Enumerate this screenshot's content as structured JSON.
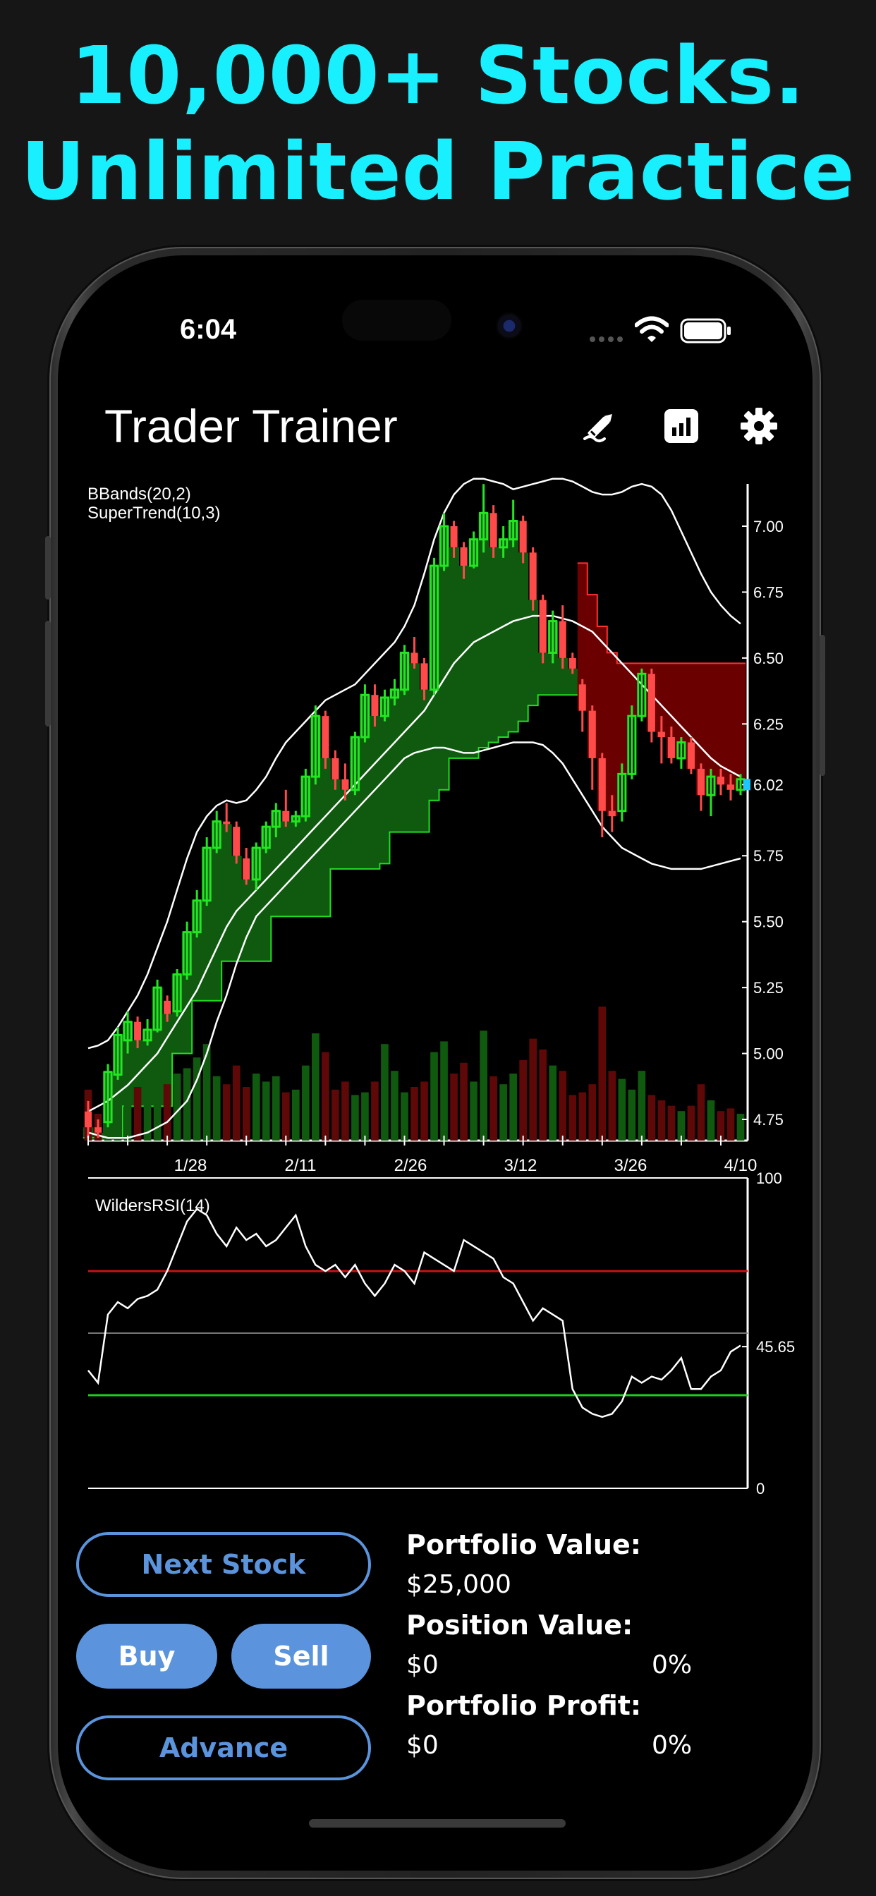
{
  "headline": {
    "line1": "10,000+ Stocks.",
    "line2": "Unlimited Practice"
  },
  "status_bar": {
    "time": "6:04"
  },
  "app": {
    "title": "Trader Trainer"
  },
  "toolbar": {
    "icons": [
      "draw-tool-icon",
      "chart-bar-icon",
      "gear-icon"
    ]
  },
  "colors": {
    "accent_cyan": "#19f0ff",
    "button_blue": "#5b94dc",
    "up": "#22e622",
    "down": "#ff4a4a",
    "fill_up": "#0f5a0f",
    "fill_down": "#6b0000"
  },
  "chart_data": [
    {
      "type": "candlestick",
      "indicators": [
        "BBands(20,2)",
        "SuperTrend(10,3)"
      ],
      "x_labels": [
        "1/28",
        "2/11",
        "2/26",
        "3/12",
        "3/26",
        "4/10"
      ],
      "y_ticks": [
        "7.00",
        "6.75",
        "6.50",
        "6.25",
        "6.02",
        "5.75",
        "5.50",
        "5.25",
        "5.00",
        "4.75"
      ],
      "current_price": "6.02",
      "ylim": [
        4.7,
        7.15
      ],
      "ohlc": [
        [
          4.78,
          4.82,
          4.68,
          4.72
        ],
        [
          4.72,
          4.75,
          4.68,
          4.7
        ],
        [
          4.74,
          4.96,
          4.72,
          4.93
        ],
        [
          4.92,
          5.1,
          4.9,
          5.07
        ],
        [
          5.05,
          5.16,
          5.0,
          5.12
        ],
        [
          5.12,
          5.14,
          5.02,
          5.05
        ],
        [
          5.05,
          5.13,
          5.03,
          5.09
        ],
        [
          5.09,
          5.28,
          5.08,
          5.25
        ],
        [
          5.2,
          5.22,
          5.12,
          5.15
        ],
        [
          5.16,
          5.32,
          5.14,
          5.3
        ],
        [
          5.3,
          5.5,
          5.28,
          5.46
        ],
        [
          5.46,
          5.62,
          5.44,
          5.58
        ],
        [
          5.58,
          5.82,
          5.56,
          5.78
        ],
        [
          5.78,
          5.92,
          5.76,
          5.88
        ],
        [
          5.88,
          5.95,
          5.84,
          5.87
        ],
        [
          5.86,
          5.88,
          5.72,
          5.75
        ],
        [
          5.74,
          5.78,
          5.64,
          5.66
        ],
        [
          5.66,
          5.8,
          5.62,
          5.78
        ],
        [
          5.78,
          5.88,
          5.76,
          5.86
        ],
        [
          5.86,
          5.95,
          5.82,
          5.92
        ],
        [
          5.92,
          6.0,
          5.86,
          5.88
        ],
        [
          5.88,
          5.92,
          5.86,
          5.9
        ],
        [
          5.9,
          6.08,
          5.88,
          6.05
        ],
        [
          6.05,
          6.32,
          6.02,
          6.28
        ],
        [
          6.28,
          6.3,
          6.08,
          6.12
        ],
        [
          6.12,
          6.15,
          6.0,
          6.04
        ],
        [
          6.04,
          6.1,
          5.96,
          6.0
        ],
        [
          6.0,
          6.22,
          5.98,
          6.2
        ],
        [
          6.2,
          6.4,
          6.18,
          6.36
        ],
        [
          6.36,
          6.4,
          6.24,
          6.28
        ],
        [
          6.28,
          6.38,
          6.26,
          6.35
        ],
        [
          6.35,
          6.42,
          6.32,
          6.38
        ],
        [
          6.38,
          6.55,
          6.36,
          6.52
        ],
        [
          6.52,
          6.58,
          6.46,
          6.48
        ],
        [
          6.48,
          6.5,
          6.34,
          6.38
        ],
        [
          6.38,
          6.88,
          6.36,
          6.85
        ],
        [
          6.85,
          7.05,
          6.83,
          7.0
        ],
        [
          7.0,
          7.02,
          6.88,
          6.92
        ],
        [
          6.92,
          6.94,
          6.8,
          6.85
        ],
        [
          6.85,
          6.98,
          6.84,
          6.95
        ],
        [
          6.95,
          7.16,
          6.9,
          7.05
        ],
        [
          7.05,
          7.08,
          6.88,
          6.92
        ],
        [
          6.92,
          7.0,
          6.88,
          6.95
        ],
        [
          6.95,
          7.1,
          6.92,
          7.02
        ],
        [
          7.02,
          7.04,
          6.86,
          6.9
        ],
        [
          6.9,
          6.92,
          6.68,
          6.72
        ],
        [
          6.72,
          6.74,
          6.48,
          6.52
        ],
        [
          6.52,
          6.68,
          6.48,
          6.64
        ],
        [
          6.64,
          6.7,
          6.46,
          6.5
        ],
        [
          6.5,
          6.52,
          6.44,
          6.46
        ],
        [
          6.4,
          6.42,
          6.22,
          6.3
        ],
        [
          6.3,
          6.32,
          6.0,
          6.12
        ],
        [
          6.12,
          6.14,
          5.82,
          5.92
        ],
        [
          5.92,
          5.98,
          5.84,
          5.9
        ],
        [
          5.92,
          6.1,
          5.88,
          6.06
        ],
        [
          6.06,
          6.32,
          6.04,
          6.28
        ],
        [
          6.28,
          6.46,
          6.26,
          6.44
        ],
        [
          6.44,
          6.46,
          6.18,
          6.22
        ],
        [
          6.22,
          6.28,
          6.1,
          6.2
        ],
        [
          6.2,
          6.24,
          6.1,
          6.12
        ],
        [
          6.12,
          6.2,
          6.08,
          6.18
        ],
        [
          6.18,
          6.2,
          6.06,
          6.08
        ],
        [
          6.08,
          6.1,
          5.92,
          5.98
        ],
        [
          5.98,
          6.08,
          5.9,
          6.05
        ],
        [
          6.05,
          6.08,
          5.98,
          6.02
        ],
        [
          6.02,
          6.06,
          5.96,
          6.0
        ],
        [
          6.0,
          6.06,
          5.98,
          6.04
        ]
      ],
      "bb_upper": [
        5.02,
        5.03,
        5.05,
        5.1,
        5.16,
        5.22,
        5.3,
        5.4,
        5.5,
        5.62,
        5.74,
        5.84,
        5.9,
        5.94,
        5.96,
        5.95,
        5.96,
        6.0,
        6.05,
        6.12,
        6.18,
        6.22,
        6.26,
        6.3,
        6.34,
        6.36,
        6.38,
        6.4,
        6.44,
        6.48,
        6.52,
        6.56,
        6.62,
        6.7,
        6.82,
        6.95,
        7.05,
        7.12,
        7.16,
        7.18,
        7.18,
        7.17,
        7.16,
        7.14,
        7.15,
        7.16,
        7.17,
        7.18,
        7.18,
        7.17,
        7.15,
        7.13,
        7.12,
        7.12,
        7.13,
        7.15,
        7.16,
        7.15,
        7.12,
        7.06,
        6.98,
        6.9,
        6.82,
        6.75,
        6.7,
        6.66,
        6.63
      ],
      "bb_mid": [
        4.78,
        4.8,
        4.82,
        4.85,
        4.88,
        4.92,
        4.96,
        5.0,
        5.06,
        5.12,
        5.18,
        5.24,
        5.32,
        5.4,
        5.48,
        5.54,
        5.58,
        5.62,
        5.66,
        5.7,
        5.74,
        5.78,
        5.82,
        5.86,
        5.9,
        5.94,
        5.98,
        6.02,
        6.06,
        6.1,
        6.14,
        6.18,
        6.22,
        6.26,
        6.3,
        6.36,
        6.42,
        6.48,
        6.52,
        6.56,
        6.58,
        6.6,
        6.62,
        6.64,
        6.65,
        6.66,
        6.66,
        6.66,
        6.65,
        6.64,
        6.62,
        6.6,
        6.56,
        6.52,
        6.48,
        6.44,
        6.4,
        6.36,
        6.32,
        6.28,
        6.24,
        6.2,
        6.16,
        6.12,
        6.09,
        6.07,
        6.05
      ],
      "bb_lower": [
        4.7,
        4.69,
        4.68,
        4.68,
        4.68,
        4.69,
        4.7,
        4.72,
        4.74,
        4.78,
        4.82,
        4.9,
        5.0,
        5.12,
        5.22,
        5.34,
        5.44,
        5.52,
        5.56,
        5.6,
        5.64,
        5.68,
        5.72,
        5.76,
        5.8,
        5.84,
        5.88,
        5.92,
        5.96,
        6.0,
        6.04,
        6.08,
        6.12,
        6.14,
        6.15,
        6.16,
        6.16,
        6.15,
        6.14,
        6.14,
        6.15,
        6.16,
        6.17,
        6.18,
        6.18,
        6.18,
        6.17,
        6.14,
        6.1,
        6.04,
        5.98,
        5.92,
        5.86,
        5.82,
        5.78,
        5.76,
        5.74,
        5.72,
        5.71,
        5.7,
        5.7,
        5.7,
        5.7,
        5.71,
        5.72,
        5.73,
        5.74
      ],
      "supertrend": [
        4.68,
        4.68,
        4.68,
        4.68,
        4.8,
        4.8,
        4.8,
        4.8,
        4.8,
        5.0,
        5.0,
        5.2,
        5.2,
        5.2,
        5.35,
        5.35,
        5.35,
        5.35,
        5.35,
        5.52,
        5.52,
        5.52,
        5.52,
        5.52,
        5.52,
        5.7,
        5.7,
        5.7,
        5.7,
        5.7,
        5.72,
        5.84,
        5.84,
        5.84,
        5.84,
        5.96,
        6.0,
        6.12,
        6.12,
        6.12,
        6.16,
        6.18,
        6.2,
        6.22,
        6.26,
        6.32,
        6.36,
        6.36,
        6.36,
        6.36,
        6.86,
        6.74,
        6.62,
        6.52,
        6.48,
        6.48,
        6.48,
        6.48,
        6.48,
        6.48,
        6.48,
        6.48,
        6.48,
        6.48,
        6.48,
        6.48,
        6.48
      ],
      "volume": [
        0.38,
        0.2,
        0.48,
        0.52,
        0.58,
        0.4,
        0.44,
        0.6,
        0.42,
        0.5,
        0.54,
        0.62,
        0.72,
        0.48,
        0.42,
        0.56,
        0.4,
        0.5,
        0.44,
        0.48,
        0.36,
        0.38,
        0.56,
        0.8,
        0.66,
        0.38,
        0.44,
        0.34,
        0.36,
        0.44,
        0.72,
        0.52,
        0.36,
        0.4,
        0.44,
        0.66,
        0.74,
        0.5,
        0.58,
        0.44,
        0.82,
        0.48,
        0.42,
        0.5,
        0.6,
        0.76,
        0.68,
        0.56,
        0.52,
        0.34,
        0.36,
        0.42,
        1.0,
        0.52,
        0.46,
        0.38,
        0.52,
        0.34,
        0.3,
        0.26,
        0.22,
        0.26,
        0.42,
        0.3,
        0.22,
        0.24,
        0.2
      ]
    },
    {
      "type": "line",
      "indicator": "WildersRSI(14)",
      "y_ticks": [
        "100",
        "45.65",
        "0"
      ],
      "current_value": "45.65",
      "levels": {
        "overbought": 70,
        "mid": 50,
        "oversold": 30
      },
      "ylim": [
        0,
        100
      ],
      "values": [
        38,
        34,
        56,
        60,
        58,
        61,
        62,
        64,
        70,
        78,
        86,
        90,
        88,
        82,
        78,
        84,
        80,
        82,
        78,
        80,
        84,
        88,
        78,
        72,
        70,
        72,
        68,
        72,
        66,
        62,
        66,
        72,
        70,
        66,
        76,
        74,
        72,
        70,
        80,
        78,
        76,
        74,
        68,
        66,
        60,
        54,
        58,
        56,
        54,
        32,
        26,
        24,
        23,
        24,
        28,
        36,
        34,
        36,
        35,
        38,
        42,
        32,
        32,
        36,
        38,
        44,
        46
      ]
    }
  ],
  "buttons": {
    "next_stock": "Next Stock",
    "buy": "Buy",
    "sell": "Sell",
    "advance": "Advance"
  },
  "stats": {
    "portfolio_value_label": "Portfolio Value:",
    "portfolio_value": "$25,000",
    "position_value_label": "Position Value:",
    "position_value": "$0",
    "position_pct": "0%",
    "portfolio_profit_label": "Portfolio Profit:",
    "portfolio_profit": "$0",
    "profit_pct": "0%"
  }
}
